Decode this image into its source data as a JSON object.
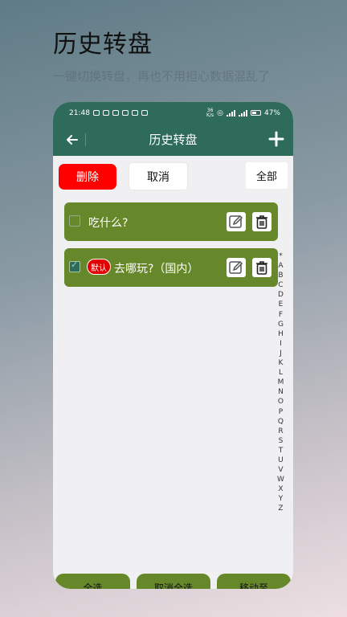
{
  "promo": {
    "title": "历史转盘",
    "subtitle": "一键切换转盘，再也不用担心数据混乱了"
  },
  "status_bar": {
    "time": "21:48",
    "network_speed": "36\nK/s",
    "battery": "47%"
  },
  "app_bar": {
    "title": "历史转盘",
    "back_icon": "arrow-left-icon",
    "add_icon": "plus-icon"
  },
  "actions": {
    "delete_label": "删除",
    "cancel_label": "取消",
    "filter_label": "全部"
  },
  "items": [
    {
      "label": "吃什么?",
      "checked": false,
      "badge": ""
    },
    {
      "label": "去哪玩?（国内）",
      "checked": true,
      "badge": "默认"
    }
  ],
  "alphabet": [
    "*",
    "A",
    "B",
    "C",
    "D",
    "E",
    "F",
    "G",
    "H",
    "I",
    "J",
    "K",
    "L",
    "M",
    "N",
    "O",
    "P",
    "Q",
    "R",
    "S",
    "T",
    "U",
    "V",
    "W",
    "X",
    "Y",
    "Z"
  ],
  "bottom_tabs": [
    "全选",
    "取消全选",
    "移动至"
  ],
  "colors": {
    "appbar": "#2e6b5a",
    "item_bg": "#66882b",
    "delete": "#ff0000",
    "badge": "#e00000"
  }
}
